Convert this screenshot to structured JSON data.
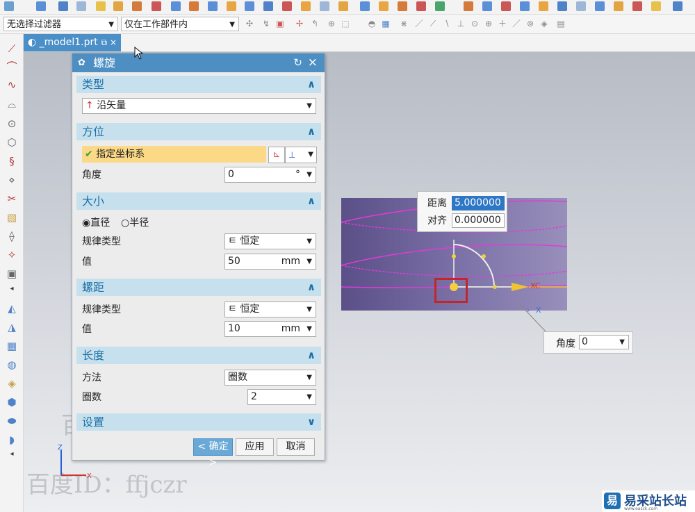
{
  "toolbar": {
    "filter_select": "无选择过滤器",
    "scope_select": "仅在工作部件内"
  },
  "tab": {
    "label": "_model1.prt",
    "pin": "⧉",
    "close": "×"
  },
  "dialog": {
    "title": "螺旋",
    "sections": {
      "type": {
        "title": "类型",
        "option": "沿矢量"
      },
      "orientation": {
        "title": "方位",
        "specify_csys": "指定坐标系",
        "angle_label": "角度",
        "angle_value": "0",
        "angle_unit": "°"
      },
      "size": {
        "title": "大小",
        "diameter": "直径",
        "radius": "半径",
        "law_label": "规律类型",
        "law_value": "恒定",
        "value_label": "值",
        "value": "50",
        "unit": "mm"
      },
      "pitch": {
        "title": "螺距",
        "law_label": "规律类型",
        "law_value": "恒定",
        "value_label": "值",
        "value": "10",
        "unit": "mm"
      },
      "length": {
        "title": "长度",
        "method_label": "方法",
        "method_value": "圈数",
        "turns_label": "圈数",
        "turns_value": "2"
      },
      "settings": {
        "title": "设置"
      }
    },
    "buttons": {
      "ok": "< 确定 >",
      "apply": "应用",
      "cancel": "取消"
    }
  },
  "viewport": {
    "distance_label": "距离",
    "distance_value": "5.000000",
    "align_label": "对齐",
    "align_value": "0.000000",
    "angle_label": "角度",
    "angle_value": "0",
    "axis_xc": "XC",
    "axis_z": "Z",
    "axis_x": "X"
  },
  "watermark": "百度ID：ffjczr",
  "logo": {
    "text": "易采站长站",
    "sub": "www.easck.com"
  }
}
